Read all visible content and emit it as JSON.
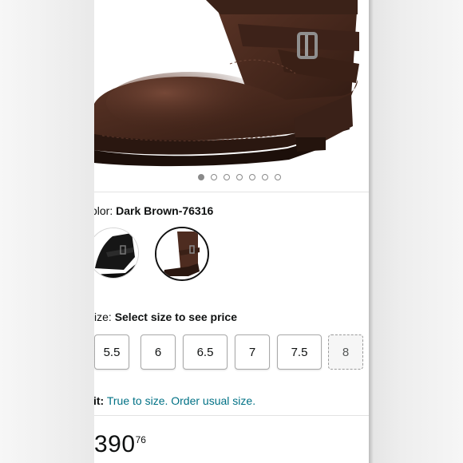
{
  "product": {
    "color_label": "olor:",
    "color_value": "Dark Brown-76316",
    "image_dots": {
      "count": 7,
      "active_index": 0
    },
    "swatches": [
      {
        "name": "black",
        "color": "#1a1a1a",
        "selected": false
      },
      {
        "name": "dark-brown",
        "color": "#4a2a1f",
        "selected": true
      }
    ],
    "size_label": "ize:",
    "size_value": "Select size to see price",
    "sizes": [
      {
        "label": "5.5",
        "available": true
      },
      {
        "label": "6",
        "available": true
      },
      {
        "label": "6.5",
        "available": true
      },
      {
        "label": "7",
        "available": true
      },
      {
        "label": "7.5",
        "available": true
      },
      {
        "label": "8",
        "available": false
      }
    ],
    "fit_label": "it:",
    "fit_value": "True to size. Order usual size.",
    "price_whole": "390",
    "price_fraction": "76"
  },
  "colors": {
    "link": "#007185",
    "text": "#0f1111",
    "boot_leather": "#4a2a1f"
  }
}
